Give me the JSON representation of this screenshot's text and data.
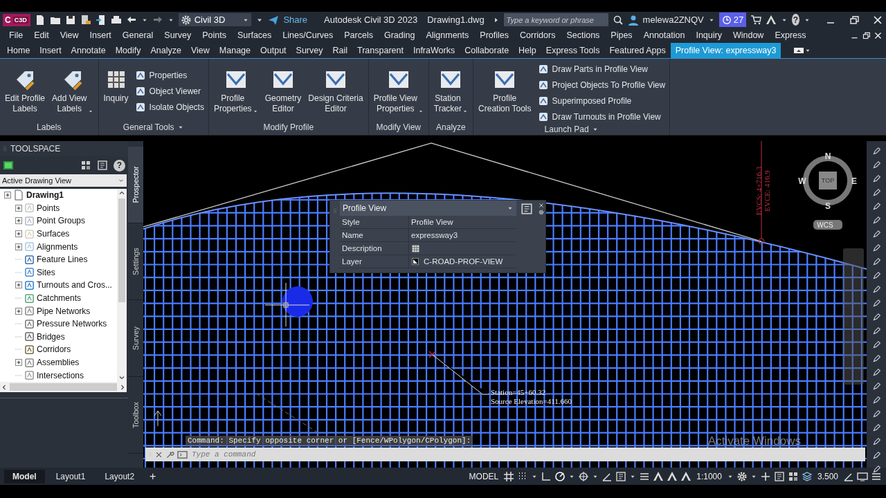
{
  "title_bar": {
    "app_badge": "C",
    "app_badge_sub": "C3D",
    "workspace": "Civil 3D",
    "share": "Share",
    "app_title": "Autodesk Civil 3D 2023",
    "file_name": "Drawing1.dwg",
    "search_placeholder": "Type a keyword or phrase",
    "user": "melewa2ZNQV",
    "trial_days": "27",
    "help": "?"
  },
  "menu": [
    "File",
    "Edit",
    "View",
    "Insert",
    "General",
    "Survey",
    "Points",
    "Surfaces",
    "Lines/Curves",
    "Parcels",
    "Grading",
    "Alignments",
    "Profiles",
    "Corridors",
    "Sections",
    "Pipes",
    "Annotation",
    "Inquiry",
    "Window",
    "Express"
  ],
  "ribbon_tabs": [
    {
      "label": "Home",
      "selected": false
    },
    {
      "label": "Insert",
      "selected": false
    },
    {
      "label": "Annotate",
      "selected": false
    },
    {
      "label": "Modify",
      "selected": false
    },
    {
      "label": "Analyze",
      "selected": false
    },
    {
      "label": "View",
      "selected": false
    },
    {
      "label": "Manage",
      "selected": false
    },
    {
      "label": "Output",
      "selected": false
    },
    {
      "label": "Survey",
      "selected": false
    },
    {
      "label": "Rail",
      "selected": false
    },
    {
      "label": "Transparent",
      "selected": false
    },
    {
      "label": "InfraWorks",
      "selected": false
    },
    {
      "label": "Collaborate",
      "selected": false
    },
    {
      "label": "Help",
      "selected": false
    },
    {
      "label": "Express Tools",
      "selected": false
    },
    {
      "label": "Featured Apps",
      "selected": false
    },
    {
      "label": "Profile View: expressway3",
      "selected": true
    }
  ],
  "ribbon_panels": [
    {
      "title": "Labels",
      "menu": false,
      "tools": [
        {
          "label": "Edit Profile\nLabels",
          "kind": "large",
          "dropdown": false
        },
        {
          "label": "Add View\nLabels",
          "kind": "large",
          "dropdown": true
        }
      ]
    },
    {
      "title": "General Tools",
      "menu": true,
      "tools": [
        {
          "label": "Inquiry",
          "kind": "large",
          "dropdown": false
        },
        {
          "label": "Properties",
          "kind": "small"
        },
        {
          "label": "Object Viewer",
          "kind": "small"
        },
        {
          "label": "Isolate Objects",
          "kind": "small"
        }
      ]
    },
    {
      "title": "Modify Profile",
      "menu": false,
      "tools": [
        {
          "label": "Profile\nProperties",
          "kind": "large",
          "dropdown": true
        },
        {
          "label": "Geometry\nEditor",
          "kind": "large",
          "dropdown": false
        },
        {
          "label": "Design Criteria\nEditor",
          "kind": "large",
          "dropdown": false
        }
      ]
    },
    {
      "title": "Modify View",
      "menu": false,
      "tools": [
        {
          "label": "Profile View\nProperties",
          "kind": "large",
          "dropdown": true
        }
      ]
    },
    {
      "title": "Analyze",
      "menu": false,
      "tools": [
        {
          "label": "Station\nTracker",
          "kind": "large",
          "dropdown": true
        }
      ]
    },
    {
      "title": "Launch Pad",
      "menu": true,
      "tools": [
        {
          "label": "Profile\nCreation Tools",
          "kind": "large",
          "dropdown": false
        },
        {
          "label": "Draw Parts in Profile View",
          "kind": "small"
        },
        {
          "label": "Project Objects To Profile View",
          "kind": "small"
        },
        {
          "label": "Superimposed Profile",
          "kind": "small"
        },
        {
          "label": "Draw Turnouts in Profile View",
          "kind": "small"
        }
      ]
    }
  ],
  "toolspace": {
    "title": "TOOLSPACE",
    "help": "?",
    "view": "Active Drawing View",
    "side_tabs": [
      {
        "label": "Prospector",
        "selected": true
      },
      {
        "label": "Settings",
        "selected": false
      },
      {
        "label": "Survey",
        "selected": false
      },
      {
        "label": "Toolbox",
        "selected": false
      }
    ],
    "tree": {
      "label": "Drawing1",
      "children": [
        {
          "label": "Points",
          "expandable": true
        },
        {
          "label": "Point Groups",
          "expandable": true
        },
        {
          "label": "Surfaces",
          "expandable": true
        },
        {
          "label": "Alignments",
          "expandable": true
        },
        {
          "label": "Feature Lines",
          "expandable": false
        },
        {
          "label": "Sites",
          "expandable": false
        },
        {
          "label": "Turnouts and Cros...",
          "expandable": true
        },
        {
          "label": "Catchments",
          "expandable": false
        },
        {
          "label": "Pipe Networks",
          "expandable": true
        },
        {
          "label": "Pressure Networks",
          "expandable": false
        },
        {
          "label": "Bridges",
          "expandable": false
        },
        {
          "label": "Corridors",
          "expandable": false
        },
        {
          "label": "Assemblies",
          "expandable": true
        },
        {
          "label": "Intersections",
          "expandable": false
        }
      ]
    }
  },
  "canvas": {
    "evc_labels": [
      "EVCS: 4+716.3",
      "EVCE: 416.9"
    ],
    "tooltip": [
      "Station=45+60.32",
      "Source Elevation=411.660"
    ],
    "compass": {
      "north": "N",
      "south": "S",
      "east": "E",
      "west": "W",
      "top": "TOP"
    },
    "ucs": "WCS",
    "watermark": "Activate Windows"
  },
  "properties": {
    "title": "Profile View",
    "rows": [
      {
        "label": "Style",
        "value": "Profile View",
        "kind": "text"
      },
      {
        "label": "Name",
        "value": "expressway3",
        "kind": "text"
      },
      {
        "label": "Description",
        "kind": "editor"
      },
      {
        "label": "Layer",
        "value": "C-ROAD-PROF-VIEW",
        "kind": "layer"
      }
    ]
  },
  "command": {
    "history": "Command: Specify opposite corner or [Fence/WPolygon/CPolygon]:",
    "placeholder": "Type a command"
  },
  "layout_tabs": [
    {
      "label": "Model",
      "selected": true
    },
    {
      "label": "Layout1",
      "selected": false
    },
    {
      "label": "Layout2",
      "selected": false
    }
  ],
  "add_layout": "+",
  "status": {
    "space": "MODEL",
    "scale": "1:1000",
    "annotation_value": "3.500"
  }
}
